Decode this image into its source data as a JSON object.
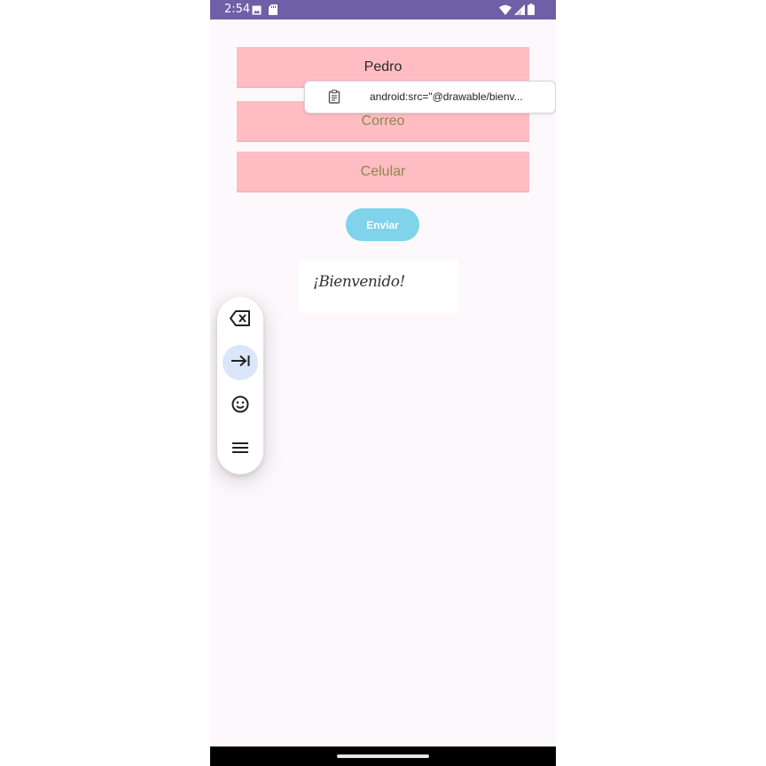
{
  "status_bar": {
    "time": "2:54",
    "left_icons": [
      "image-notification-icon",
      "sd-card-icon"
    ],
    "right_icons": [
      "wifi-icon",
      "signal-icon",
      "battery-icon"
    ]
  },
  "form": {
    "name_field": {
      "value": "Pedro",
      "placeholder": ""
    },
    "email_field": {
      "value": "",
      "placeholder": "Correo"
    },
    "phone_field": {
      "value": "",
      "placeholder": "Celular"
    },
    "send_label": "Enviar"
  },
  "clipboard_suggestion": {
    "icon": "clipboard-icon",
    "text": "android:src=\"@drawable/bienv..."
  },
  "welcome_image": {
    "text": "¡Bienvenido!"
  },
  "keyboard_toolbar": {
    "buttons": [
      {
        "icon": "backspace-icon",
        "active": false
      },
      {
        "icon": "tab-icon",
        "active": true
      },
      {
        "icon": "emoji-icon",
        "active": false
      },
      {
        "icon": "menu-icon",
        "active": false
      }
    ]
  },
  "colors": {
    "status_bar": "#6e5fa6",
    "field_background": "#ffbcc2",
    "button": "#7fd3ea",
    "screen_background": "#fdf8fb"
  }
}
